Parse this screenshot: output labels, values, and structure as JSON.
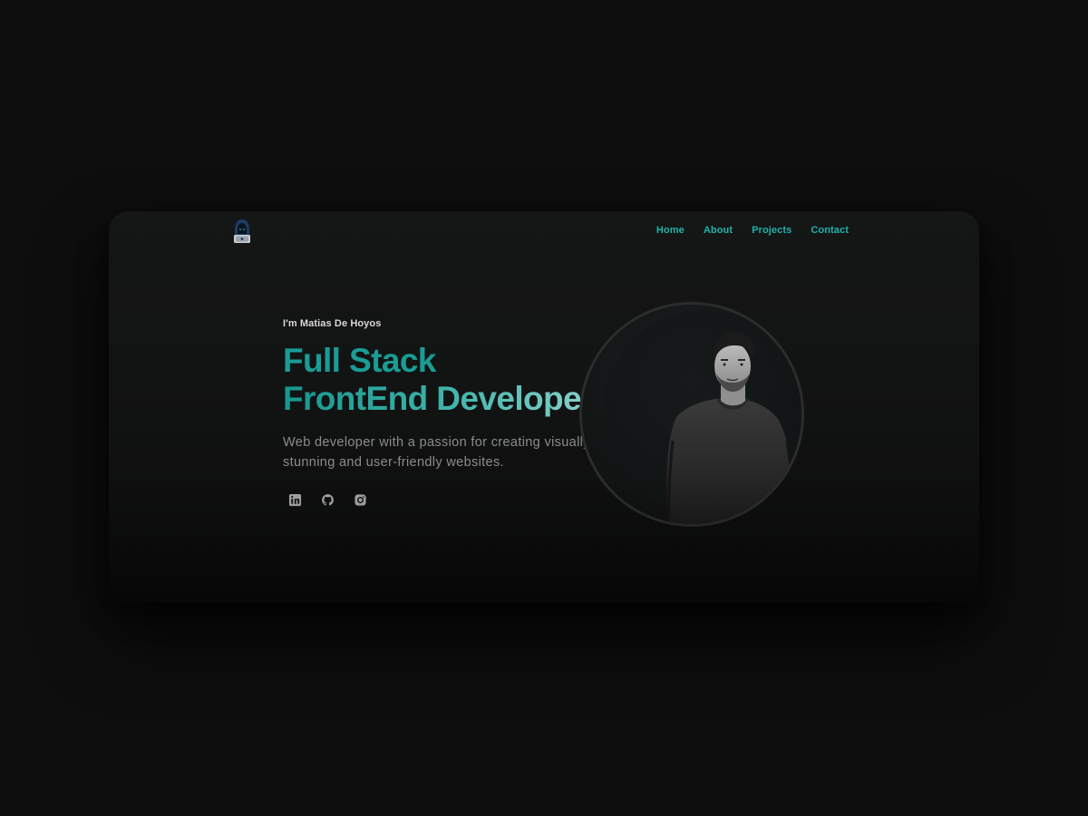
{
  "nav": {
    "logo_icon": "hooded-hacker-logo",
    "links": [
      "Home",
      "About",
      "Projects",
      "Contact"
    ]
  },
  "hero": {
    "greeting": "I'm Matias De Hoyos",
    "title_line1": "Full Stack",
    "title_line2": "FrontEnd Developer",
    "description": "Web developer with a passion for creating visually stunning and user-friendly websites."
  },
  "socials": [
    "linkedin-icon",
    "github-icon",
    "instagram-icon"
  ],
  "portrait": {
    "alt": "portrait photo"
  },
  "colors": {
    "background": "#0e0e0e",
    "card": "#141515",
    "accent": "#1fb3ab",
    "title_start": "#14978f",
    "title_end": "#a3dcd6",
    "text_muted": "#8c8c8c"
  }
}
